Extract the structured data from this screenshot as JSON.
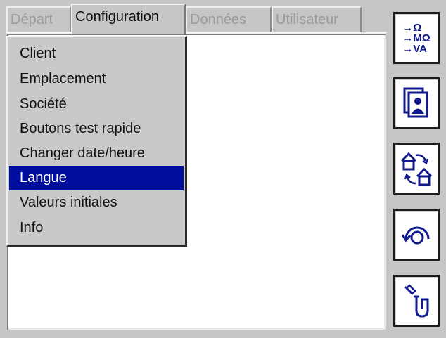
{
  "tabs": [
    {
      "label": "Départ",
      "active": false
    },
    {
      "label": "Configuration",
      "active": true
    },
    {
      "label": "Données",
      "active": false
    },
    {
      "label": "Utilisateur",
      "active": false
    }
  ],
  "menu": {
    "items": [
      {
        "label": "Client"
      },
      {
        "label": "Emplacement"
      },
      {
        "label": "Société"
      },
      {
        "label": "Boutons test rapide"
      },
      {
        "label": "Changer date/heure"
      },
      {
        "label": "Langue",
        "selected": true
      },
      {
        "label": "Valeurs initiales"
      },
      {
        "label": "Info"
      }
    ]
  },
  "sidebar": {
    "units_button": {
      "lines": [
        "→Ω",
        "→MΩ",
        "→VA"
      ],
      "icon": "units-icon"
    },
    "buttons": [
      {
        "icon": "user-records-icon"
      },
      {
        "icon": "site-transfer-icon"
      },
      {
        "icon": "rotate-icon"
      },
      {
        "icon": "probe-icon"
      }
    ]
  },
  "colors": {
    "selection": "#000fa0",
    "icon_blue": "#101a8c",
    "panel": "#ffffff",
    "chrome": "#c6c6c6"
  }
}
